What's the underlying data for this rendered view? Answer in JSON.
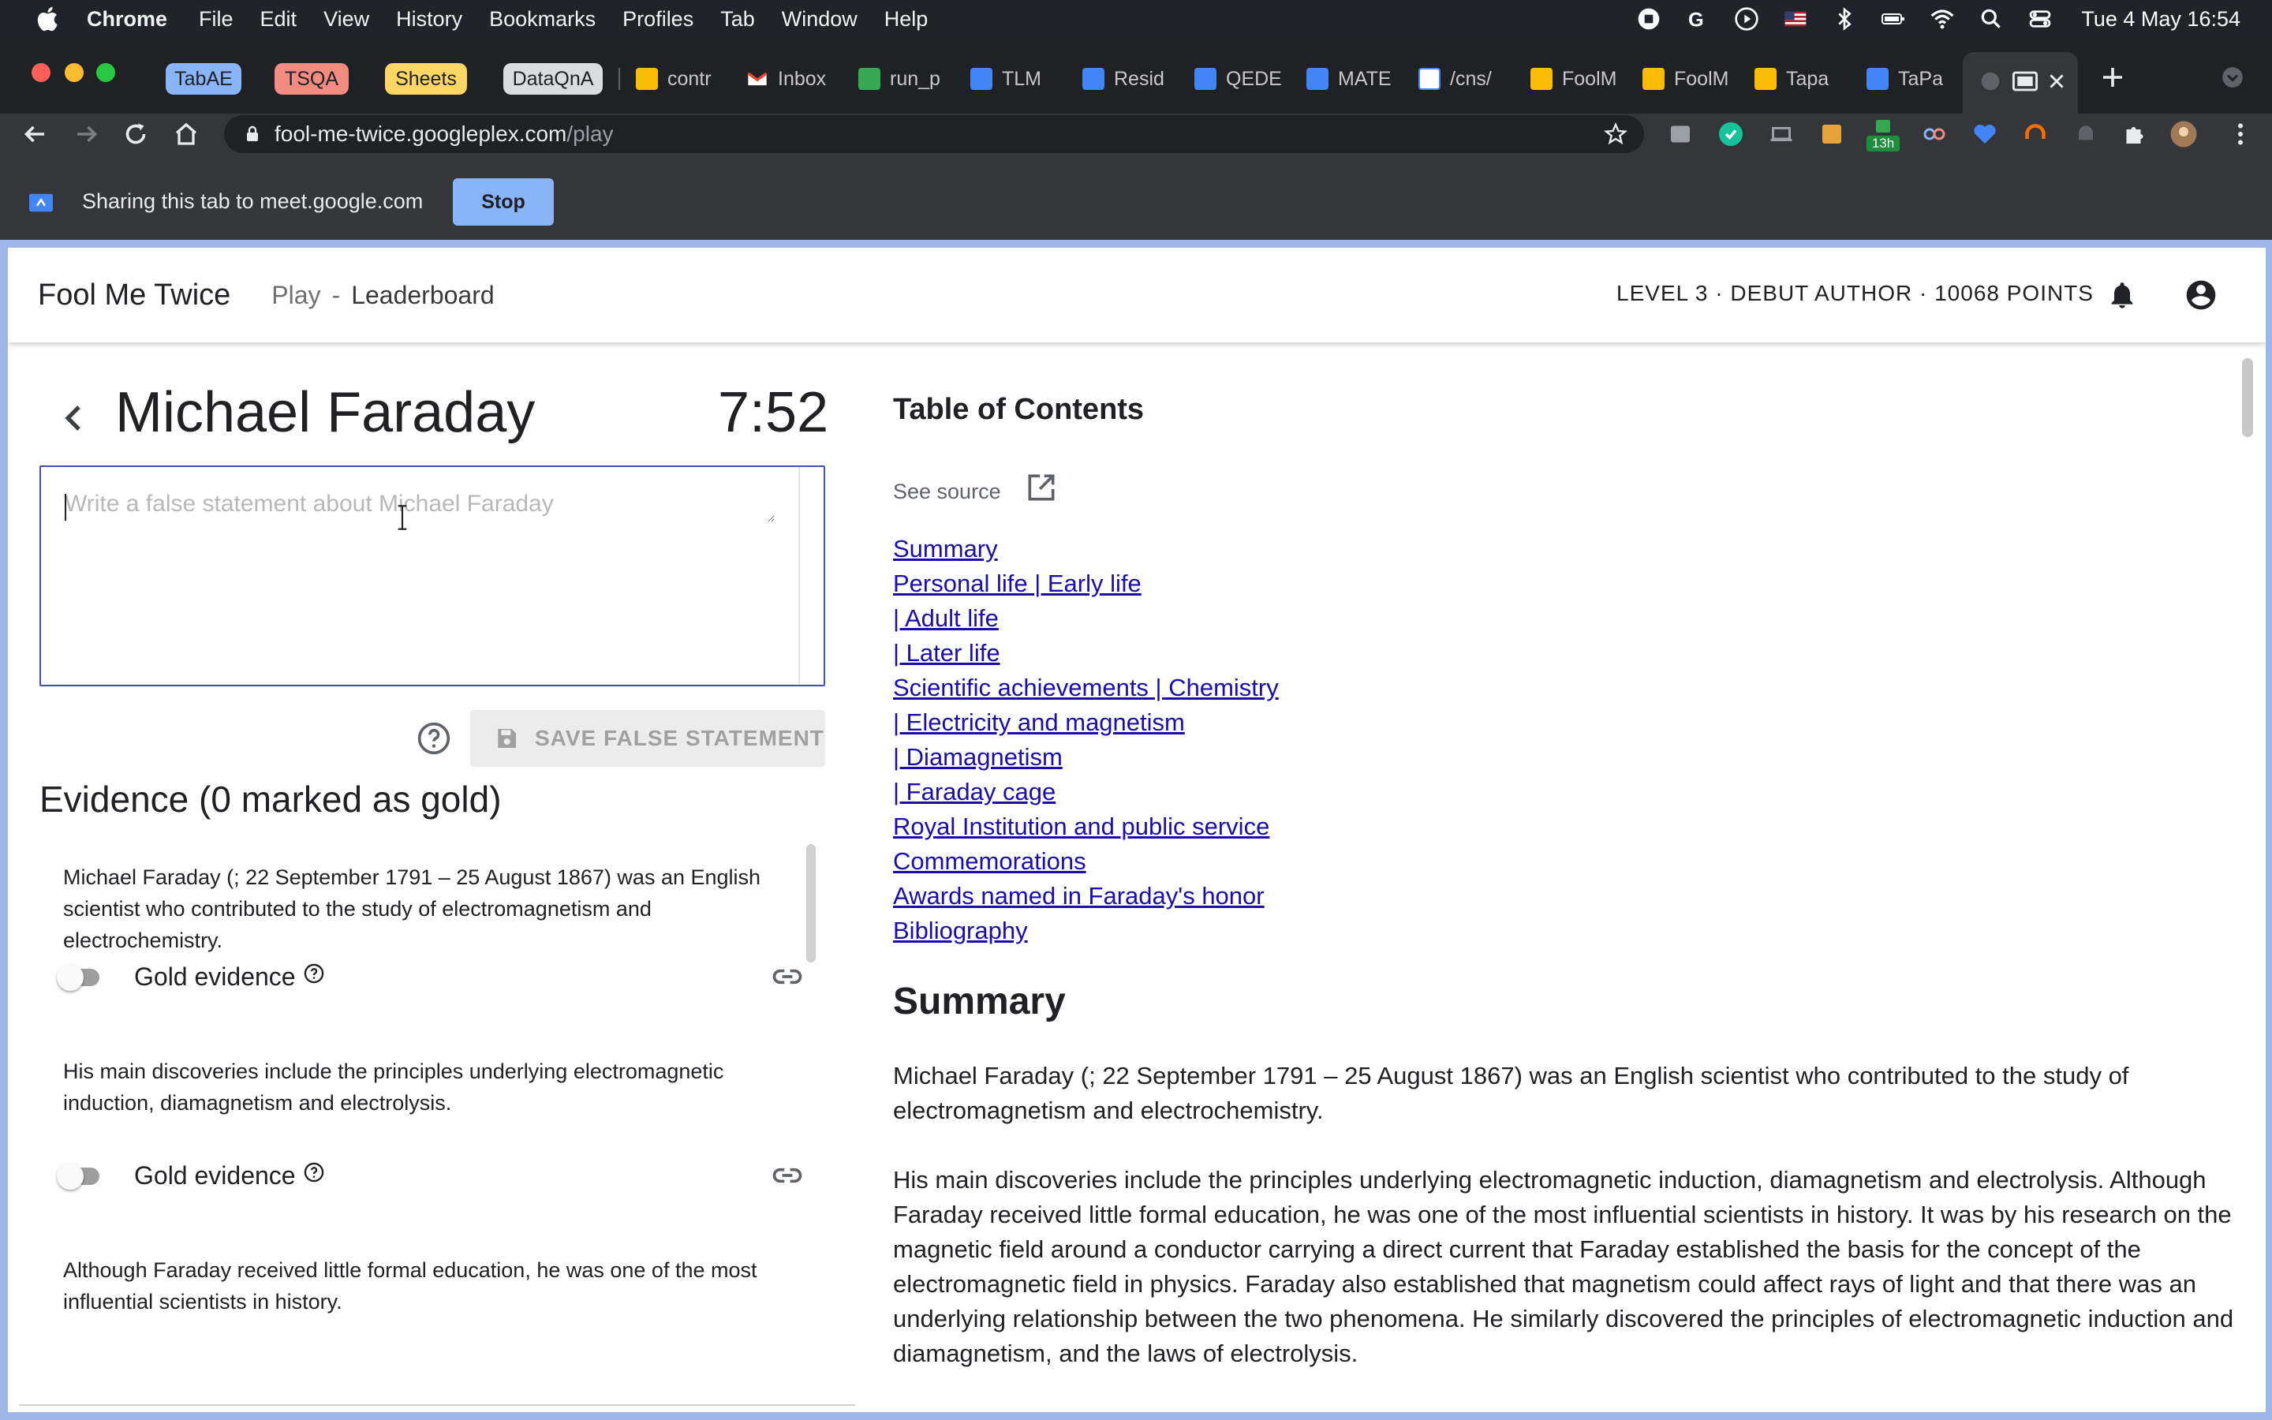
{
  "menubar": {
    "app": "Chrome",
    "items": [
      "File",
      "Edit",
      "View",
      "History",
      "Bookmarks",
      "Profiles",
      "Tab",
      "Window",
      "Help"
    ],
    "clock": "Tue 4 May  16:54"
  },
  "tabs": {
    "groups": [
      {
        "label": "TabAE",
        "color": "#8ab4f8"
      },
      {
        "label": "TSQA",
        "color": "#f28b82"
      },
      {
        "label": "Sheets",
        "color": "#fdd663"
      },
      {
        "label": "DataQnA",
        "color": "#dadce0"
      }
    ],
    "items": [
      {
        "label": "contr",
        "icon": "slides-icon",
        "color": "#fbbc04"
      },
      {
        "label": "Inbox",
        "icon": "gmail-icon",
        "color": "#ea4335"
      },
      {
        "label": "run_p",
        "icon": "check-icon",
        "color": "#34a853"
      },
      {
        "label": "TLM",
        "icon": "docs-icon",
        "color": "#4285f4"
      },
      {
        "label": "Resid",
        "icon": "docs-icon",
        "color": "#4285f4"
      },
      {
        "label": "QEDE",
        "icon": "docs-icon",
        "color": "#4285f4"
      },
      {
        "label": "MATE",
        "icon": "docs-icon",
        "color": "#4285f4"
      },
      {
        "label": "/cns/",
        "icon": "cns-icon",
        "color": "#4285f4"
      },
      {
        "label": "FoolM",
        "icon": "slides-icon",
        "color": "#fbbc04"
      },
      {
        "label": "FoolM",
        "icon": "slides-icon",
        "color": "#fbbc04"
      },
      {
        "label": "Tapa",
        "icon": "slides-icon",
        "color": "#fbbc04"
      },
      {
        "label": "TaPa",
        "icon": "docs-icon",
        "color": "#4285f4"
      }
    ]
  },
  "address": {
    "host": "fool-me-twice.googleplex.com",
    "path": "/play"
  },
  "toolbar": {
    "extension_badge": "13h"
  },
  "sharing": {
    "message": "Sharing this tab to meet.google.com",
    "stop_label": "Stop"
  },
  "app": {
    "title": "Fool Me Twice",
    "nav_play": "Play",
    "nav_separator": "-",
    "nav_leaderboard": "Leaderboard",
    "status": "LEVEL 3 · DEBUT AUTHOR · 10068 POINTS"
  },
  "game": {
    "topic": "Michael Faraday",
    "timer": "7:52",
    "statement_placeholder": "Write a false statement about Michael Faraday",
    "save_label": "SAVE FALSE STATEMENT"
  },
  "evidence": {
    "heading": "Evidence (0 marked as gold)",
    "gold_label": "Gold evidence",
    "items": [
      {
        "text": "Michael Faraday (; 22 September 1791 – 25 August 1867) was an English scientist who contributed to the study of electromagnetism and electrochemistry.",
        "gold": false
      },
      {
        "text": "His main discoveries include the principles underlying electromagnetic induction, diamagnetism and electrolysis.",
        "gold": false
      },
      {
        "text": "Although Faraday received little formal education, he was one of the most influential scientists in history.",
        "gold": false
      }
    ]
  },
  "article": {
    "toc_heading": "Table of Contents",
    "see_source": "See source",
    "toc": [
      "Summary",
      "Personal life | Early life",
      "| Adult life",
      "| Later life",
      "Scientific achievements | Chemistry",
      "| Electricity and magnetism",
      "| Diamagnetism",
      "| Faraday cage",
      "Royal Institution and public service",
      "Commemorations",
      "Awards named in Faraday's honor",
      "Bibliography"
    ],
    "summary_heading": "Summary",
    "summary_p1": "Michael Faraday (; 22 September 1791 – 25 August 1867) was an English scientist who contributed to the study of electromagnetism and electrochemistry.",
    "summary_p2": "His main discoveries include the principles underlying electromagnetic induction, diamagnetism and electrolysis. Although Faraday received little formal education, he was one of the most influential scientists in history. It was by his research on the magnetic field around a conductor carrying a direct current that Faraday established the basis for the concept of the electromagnetic field in physics. Faraday also established that magnetism could affect rays of light and that there was an underlying relationship between the two phenomena. He similarly discovered the principles of electromagnetic induction and diamagnetism, and the laws of electrolysis."
  },
  "colors": {
    "accent": "#3f51b5",
    "link": "#1a0dab",
    "share_button": "#8ab4f8",
    "page_frame": "#9fb6e8"
  }
}
